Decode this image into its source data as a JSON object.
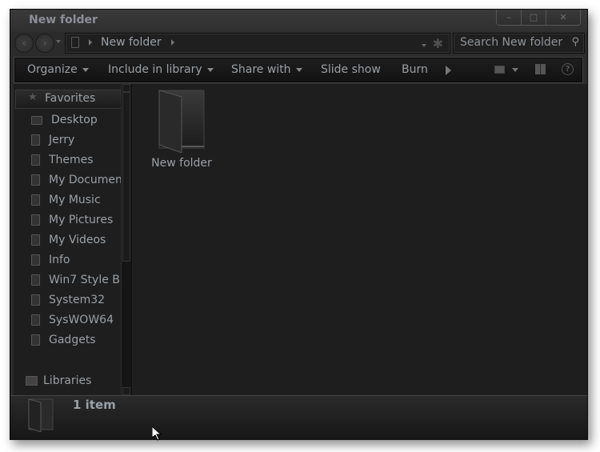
{
  "window": {
    "title": "New folder",
    "controls": {
      "minimize": "minimize-icon",
      "maximize": "maximize-icon",
      "close": "close-icon"
    }
  },
  "navigation": {
    "back_icon": "back-arrow-icon",
    "forward_icon": "forward-arrow-icon",
    "breadcrumb": [
      "New folder"
    ],
    "search_placeholder": "Search New folder"
  },
  "toolbar": {
    "items": [
      {
        "label": "Organize",
        "has_dropdown": true
      },
      {
        "label": "Include in library",
        "has_dropdown": true
      },
      {
        "label": "Share with",
        "has_dropdown": true
      },
      {
        "label": "Slide show",
        "has_dropdown": false
      },
      {
        "label": "Burn",
        "has_dropdown": false
      }
    ],
    "right_icons": [
      "more-arrow-icon",
      "change-view-icon",
      "preview-pane-icon",
      "help-icon"
    ]
  },
  "sidebar": {
    "favorites_label": "Favorites",
    "items": [
      {
        "label": "Desktop",
        "icon": "desktop-icon"
      },
      {
        "label": "Jerry",
        "icon": "folder-icon"
      },
      {
        "label": "Themes",
        "icon": "folder-icon"
      },
      {
        "label": "My Documents",
        "icon": "documents-icon"
      },
      {
        "label": "My Music",
        "icon": "music-icon"
      },
      {
        "label": "My Pictures",
        "icon": "pictures-icon"
      },
      {
        "label": "My Videos",
        "icon": "videos-icon"
      },
      {
        "label": "Info",
        "icon": "folder-icon"
      },
      {
        "label": "Win7 Style B",
        "icon": "folder-icon"
      },
      {
        "label": "System32",
        "icon": "folder-icon"
      },
      {
        "label": "SysWOW64",
        "icon": "folder-icon"
      },
      {
        "label": "Gadgets",
        "icon": "folder-icon"
      }
    ],
    "libraries_label": "Libraries"
  },
  "content": {
    "items": [
      {
        "label": "New folder",
        "icon": "folder-icon"
      }
    ]
  },
  "details": {
    "count": "1 item"
  }
}
